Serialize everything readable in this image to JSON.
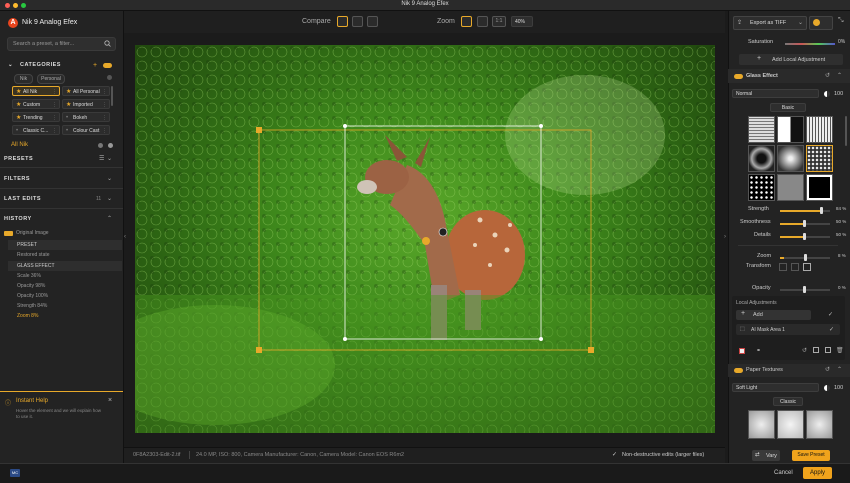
{
  "window": {
    "title": "Nik 9 Analog Efex"
  },
  "app": {
    "name": "Nik 9 Analog Efex",
    "logo_letter": "A"
  },
  "search": {
    "placeholder": "Search a preset, a filter..."
  },
  "categories": {
    "title": "CATEGORIES",
    "filters": [
      "Nik",
      "Personal"
    ],
    "items": [
      {
        "label": "All Nik",
        "starred": true,
        "active": true
      },
      {
        "label": "All Personal",
        "starred": true,
        "active": false
      },
      {
        "label": "Custom",
        "starred": true,
        "active": false
      },
      {
        "label": "Imported",
        "starred": true,
        "active": false
      },
      {
        "label": "Trending",
        "starred": true,
        "active": false
      },
      {
        "label": "Bokeh",
        "starred": false,
        "active": false
      },
      {
        "label": "Classic C...",
        "starred": false,
        "active": false
      },
      {
        "label": "Colour Cast",
        "starred": false,
        "active": false
      }
    ],
    "current_label": "All Nik"
  },
  "sections": {
    "presets": "PRESETS",
    "filters": "FILTERS",
    "last_edits": "LAST EDITS",
    "last_edits_count": "11",
    "history": "HISTORY"
  },
  "history": {
    "items": [
      {
        "label": "Original Image",
        "state": "first"
      },
      {
        "label": "PRESET",
        "state": "sel"
      },
      {
        "label": "Restored state",
        "state": ""
      },
      {
        "label": "GLASS EFFECT",
        "state": "sel"
      },
      {
        "label": "Scale 36%",
        "state": ""
      },
      {
        "label": "Opacity 98%",
        "state": ""
      },
      {
        "label": "Opacity 100%",
        "state": ""
      },
      {
        "label": "Strength 84%",
        "state": ""
      },
      {
        "label": "Zoom 8%",
        "state": "cur"
      }
    ]
  },
  "instant_help": {
    "title": "Instant Help",
    "text": "Hover the element and we will explain how to use it."
  },
  "toolbar": {
    "compare_label": "Compare",
    "zoom_label": "Zoom",
    "zoom_ratio": "1:1",
    "zoom_value": "40%"
  },
  "status": {
    "filename": "0F8A2303-Edit-2.tif",
    "info": "24.0 MP, ISO: 800, Camera Manufacturer: Canon, Camera Model: Canon EOS R6m2",
    "nondestructive": "Non-destructive edits (larger files)"
  },
  "export": {
    "label": "Export as TIFF"
  },
  "saturation": {
    "label": "Saturation",
    "value": "0%"
  },
  "add_local": "Add Local Adjustment",
  "glass": {
    "title": "Glass Effect",
    "blend_mode": "Normal",
    "opacity": "100",
    "texture_set": "Basic",
    "sliders": [
      {
        "label": "Strength",
        "value": "84 %",
        "level": 0.84
      },
      {
        "label": "Smoothness",
        "value": "50 %",
        "level": 0.5
      },
      {
        "label": "Details",
        "value": "50 %",
        "level": 0.5
      }
    ],
    "zoom": {
      "label": "Zoom",
      "value": "8 %",
      "level": 0.08
    },
    "transform_label": "Transform",
    "opacity_row": {
      "label": "Opacity",
      "value": "0 %",
      "level": 0
    }
  },
  "local_adjustments": {
    "title": "Local Adjustments",
    "add_label": "Add",
    "mask_label": "AI Mask Area 1"
  },
  "paper": {
    "title": "Paper Textures",
    "blend_mode": "Soft Light",
    "opacity": "100",
    "texture_set": "Classic"
  },
  "bottom": {
    "vary": "Vary",
    "save_preset": "Save Preset",
    "cancel": "Cancel",
    "apply": "Apply"
  },
  "colors": {
    "accent": "#f0a31c",
    "panel": "#232323",
    "background": "#1b1b1b"
  }
}
